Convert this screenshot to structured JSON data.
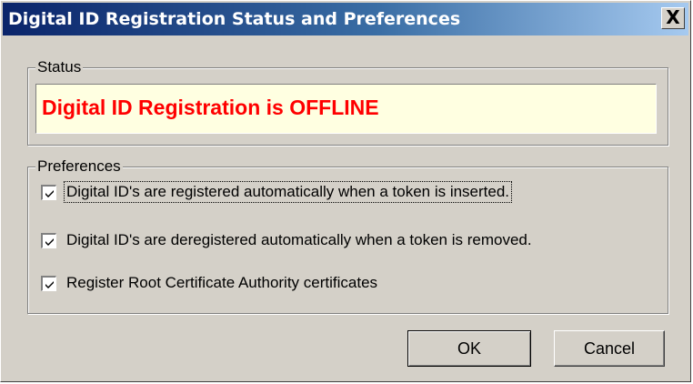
{
  "window": {
    "title": "Digital ID Registration Status and Preferences",
    "close_glyph": "X",
    "title_color_start": "#0a246a",
    "title_color_end": "#a6caf0",
    "face_color": "#d4d0c8"
  },
  "status": {
    "group_label": "Status",
    "message": "Digital ID Registration is OFFLINE",
    "message_color": "#ff0000",
    "field_background": "#ffffe1"
  },
  "preferences": {
    "group_label": "Preferences",
    "items": [
      {
        "label": "Digital ID's are registered automatically when a token is inserted.",
        "checked": true,
        "icon": "checkmark-icon"
      },
      {
        "label": "Digital ID's are deregistered automatically when a token is removed.",
        "checked": true,
        "icon": "checkmark-icon"
      },
      {
        "label": "Register Root Certificate Authority certificates",
        "checked": true,
        "icon": "checkmark-icon"
      }
    ]
  },
  "buttons": {
    "ok_label": "OK",
    "cancel_label": "Cancel"
  }
}
